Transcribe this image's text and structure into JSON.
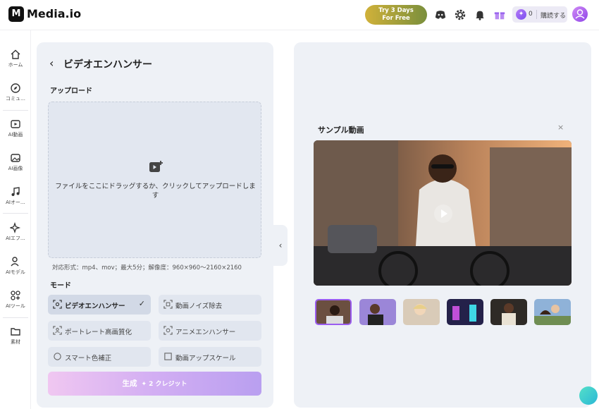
{
  "app": {
    "name": "Media.io",
    "logo_letter": "M"
  },
  "header": {
    "promo_line1": "Try 3 Days",
    "promo_line2": "For Free",
    "credits_count": "0",
    "subscribe_label": "購読する"
  },
  "sidebar": {
    "items": [
      {
        "label": "ホーム",
        "icon": "home-icon"
      },
      {
        "label": "コミュ…",
        "icon": "compass-icon"
      },
      {
        "label": "AI動画",
        "icon": "ai-video-icon"
      },
      {
        "label": "AI画像",
        "icon": "ai-image-icon"
      },
      {
        "label": "AIオー…",
        "icon": "ai-audio-icon"
      },
      {
        "label": "AIエフ…",
        "icon": "ai-effects-icon"
      },
      {
        "label": "AIモデル",
        "icon": "ai-model-icon"
      },
      {
        "label": "AIツール",
        "icon": "ai-tools-icon"
      },
      {
        "label": "素材",
        "icon": "folder-icon"
      }
    ]
  },
  "editor": {
    "title": "ビデオエンハンサー",
    "upload_section": "アップロード",
    "upload_prompt": "ファイルをここにドラッグするか、クリックしてアップロードします",
    "formats": "対応形式：mp4、mov；最大5分；解像度：960×960〜2160×2160",
    "mode_section": "モード",
    "modes": [
      {
        "label": "ビデオエンハンサー",
        "active": true
      },
      {
        "label": "動画ノイズ除去",
        "active": false
      },
      {
        "label": "ポートレート高画質化",
        "active": false
      },
      {
        "label": "アニメエンハンサー",
        "active": false
      },
      {
        "label": "スマート色補正",
        "active": false
      },
      {
        "label": "動画アップスケール",
        "active": false
      }
    ],
    "generate_label": "生成",
    "generate_credits": "✦ 2 クレジット"
  },
  "sample": {
    "title": "サンプル動画",
    "close": "×",
    "thumbnail_count": 6
  },
  "colors": {
    "accent": "#9a5cf0",
    "panel": "#eef1f6"
  }
}
